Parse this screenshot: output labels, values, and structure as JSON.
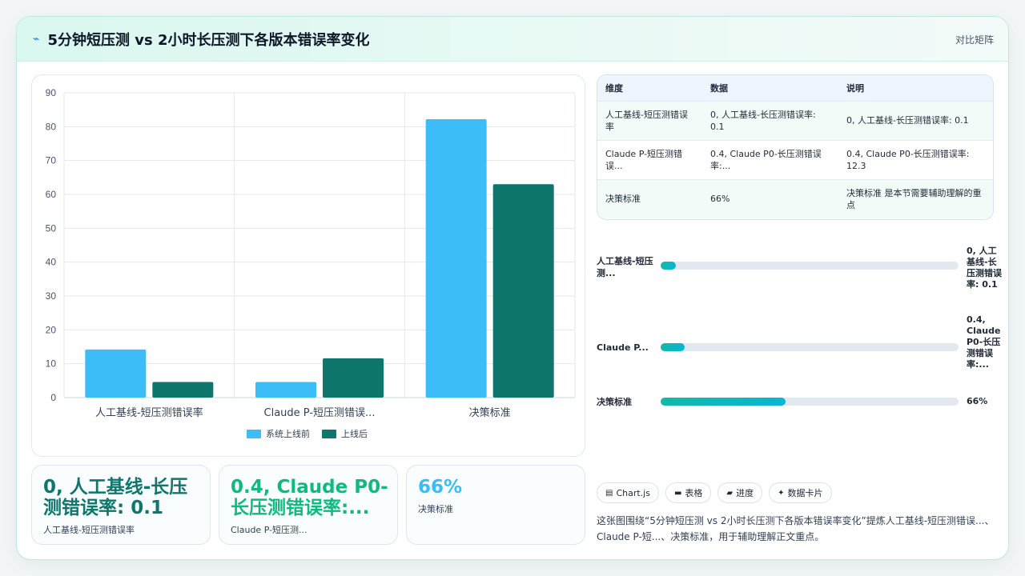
{
  "header": {
    "title_icon": "chart-line-icon",
    "title": "5分钟短压测 vs 2小时长压测下各版本错误率变化",
    "right_label": "对比矩阵"
  },
  "chart_data": {
    "type": "bar",
    "categories": [
      "人工基线-短压测错误率",
      "Claude P-短压测错误...",
      "决策标准"
    ],
    "series": [
      {
        "name": "系统上线前",
        "values": [
          14.2,
          4.6,
          82.2
        ],
        "color": "#3dbdf7"
      },
      {
        "name": "上线后",
        "values": [
          4.6,
          11.6,
          63.0
        ],
        "color": "#0f766e"
      }
    ],
    "ylim": [
      0,
      90
    ],
    "yticks": [
      0,
      10,
      20,
      30,
      40,
      50,
      60,
      70,
      80,
      90
    ],
    "grid": true,
    "legend": "bottom"
  },
  "table": {
    "headers": [
      "维度",
      "数据",
      "说明"
    ],
    "rows": [
      [
        "人工基线-短压测错误率",
        "0, 人工基线-长压测错误率: 0.1",
        "0, 人工基线-长压测错误率: 0.1"
      ],
      [
        "Claude P-短压测错误...",
        "0.4, Claude P0-长压测错误率:...",
        "0.4, Claude P0-长压测错误率: 12.3"
      ],
      [
        "决策标准",
        "66%",
        "决策标准 是本节需要辅助理解的重点"
      ]
    ]
  },
  "progress": [
    {
      "label": "人工基线-短压测...",
      "value_text": "0, 人工基线-长压测错误率: 0.1",
      "fraction": 0.05
    },
    {
      "label": "Claude P...",
      "value_text": "0.4, Claude P0-长压测错误率:...",
      "fraction": 0.08
    },
    {
      "label": "决策标准",
      "value_text": "66%",
      "fraction": 0.42
    }
  ],
  "stats": [
    {
      "big": "0, 人工基线-长压测错误率: 0.1",
      "small": "人工基线-短压测错误率",
      "color": "#0f766e"
    },
    {
      "big": "0.4, Claude P0-长压测错误率:...",
      "small": "Claude P-短压测...",
      "color": "#10b981"
    },
    {
      "big": "66%",
      "small": "决策标准",
      "color": "#38bdf8"
    }
  ],
  "chips": [
    {
      "icon": "window-icon",
      "glyph": "▤",
      "label": "Chart.js"
    },
    {
      "icon": "table-icon",
      "glyph": "▬",
      "label": "表格"
    },
    {
      "icon": "progress-icon",
      "glyph": "▰",
      "label": "进度"
    },
    {
      "icon": "sparkle-icon",
      "glyph": "✦",
      "label": "数据卡片"
    }
  ],
  "summary": "这张图围绕“5分钟短压测 vs 2小时长压测下各版本错误率变化”提炼人工基线-短压测错误...、Claude P-短...、决策标准，用于辅助理解正文重点。"
}
